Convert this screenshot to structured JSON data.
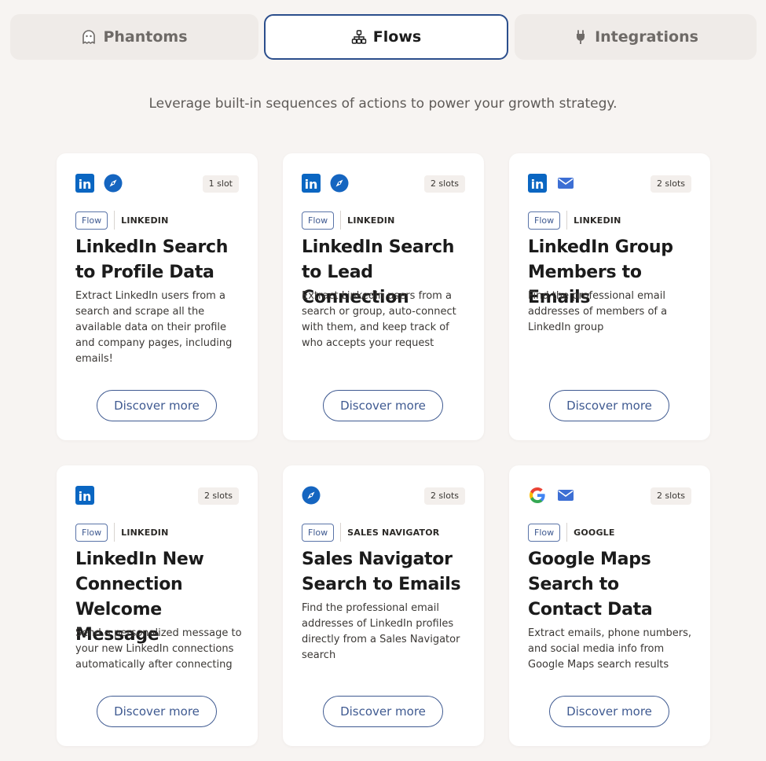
{
  "tabs": [
    {
      "label": "Phantoms",
      "icon": "ghost-icon",
      "active": false
    },
    {
      "label": "Flows",
      "icon": "flow-network-icon",
      "active": true
    },
    {
      "label": "Integrations",
      "icon": "plug-icon",
      "active": false
    }
  ],
  "subtitle": "Leverage built-in sequences of actions to power your growth strategy.",
  "cards": [
    {
      "icons": [
        "linkedin-icon",
        "compass-icon"
      ],
      "slots": "1 slot",
      "tag": "Flow",
      "source": "LINKEDIN",
      "title": "LinkedIn Search to Profile Data",
      "description": "Extract LinkedIn users from a search and scrape all the available data on their profile and company pages, including emails!",
      "button": "Discover more"
    },
    {
      "icons": [
        "linkedin-icon",
        "compass-icon"
      ],
      "slots": "2 slots",
      "tag": "Flow",
      "source": "LINKEDIN",
      "title": "LinkedIn Search to Lead Connection",
      "description": "Extract LinkedIn users from a search or group, auto-connect with them, and keep track of who accepts your request",
      "button": "Discover more"
    },
    {
      "icons": [
        "linkedin-icon",
        "mail-icon"
      ],
      "slots": "2 slots",
      "tag": "Flow",
      "source": "LINKEDIN",
      "title": "LinkedIn Group Members to Emails",
      "description": "Find the professional email addresses of members of a LinkedIn group",
      "button": "Discover more"
    },
    {
      "icons": [
        "linkedin-icon"
      ],
      "slots": "2 slots",
      "tag": "Flow",
      "source": "LINKEDIN",
      "title": "LinkedIn New Connection Welcome Message",
      "description": "Send a personalized message to your new LinkedIn connections automatically after connecting",
      "button": "Discover more"
    },
    {
      "icons": [
        "compass-icon"
      ],
      "slots": "2 slots",
      "tag": "Flow",
      "source": "SALES NAVIGATOR",
      "title": "Sales Navigator Search to Emails",
      "description": "Find the professional email addresses of LinkedIn profiles directly from a Sales Navigator search",
      "button": "Discover more"
    },
    {
      "icons": [
        "google-icon",
        "mail-icon"
      ],
      "slots": "2 slots",
      "tag": "Flow",
      "source": "GOOGLE",
      "title": "Google Maps Search to Contact Data",
      "description": "Extract emails, phone numbers, and social media info from Google Maps search results",
      "button": "Discover more"
    }
  ],
  "colors": {
    "accent": "#3f5a91",
    "linkedin": "#0a66c2",
    "compass": "#1565c0",
    "mail": "#3d6fd4",
    "background": "#f7f4f2"
  }
}
